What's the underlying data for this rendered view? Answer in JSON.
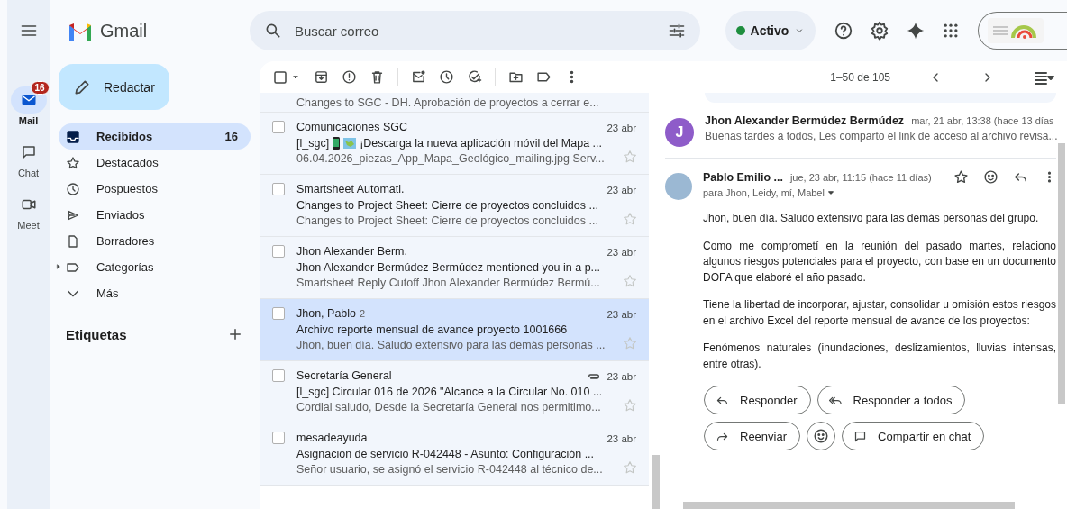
{
  "rail": {
    "items": [
      {
        "label": "Mail",
        "badge": "16",
        "selected": true
      },
      {
        "label": "Chat",
        "selected": false
      },
      {
        "label": "Meet",
        "selected": false
      }
    ]
  },
  "header": {
    "app_name": "Gmail",
    "search": {
      "placeholder": "Buscar correo"
    },
    "status": {
      "label": "Activo",
      "online": true
    }
  },
  "compose": "Redactar",
  "nav": {
    "items": [
      {
        "label": "Recibidos",
        "count": "16",
        "selected": true
      },
      {
        "label": "Destacados",
        "selected": false
      },
      {
        "label": "Pospuestos",
        "selected": false
      },
      {
        "label": "Enviados",
        "selected": false
      },
      {
        "label": "Borradores",
        "selected": false
      },
      {
        "label": "Categorías",
        "selected": false,
        "expanded": false
      },
      {
        "label": "Más",
        "selected": false
      }
    ],
    "labels_heading": "Etiquetas"
  },
  "toolbar": {
    "select_all": false,
    "range": "1–50 de 105"
  },
  "list": {
    "cut_snippet": "Changes to SGC - DH. Aprobación de proyectos a cerrar e...",
    "rows": [
      {
        "sender": "Comunicaciones SGC",
        "subject_prefix": "[l_sgc]",
        "inline_icons": true,
        "subject": "¡Descarga la nueva aplicación móvil del Mapa ...",
        "snippet": "06.04.2026_piezas_App_Mapa_Geológico_mailing.jpg Serv...",
        "date": "23 abr",
        "attachment": false,
        "selected": false,
        "checked": false,
        "starred": false
      },
      {
        "sender": "Smartsheet Automati.",
        "subject": "Changes to Project Sheet: Cierre de proyectos concluidos ...",
        "snippet": "Changes to Project Sheet: Cierre de proyectos concluidos ...",
        "date": "23 abr",
        "attachment": false,
        "selected": false,
        "checked": false,
        "starred": false
      },
      {
        "sender": "Jhon Alexander Berm.",
        "subject": "Jhon Alexander Bermúdez Bermúdez mentioned you in a p...",
        "snippet": "Smartsheet Reply Cutoff Jhon Alexander Bermúdez Bermú...",
        "date": "23 abr",
        "attachment": false,
        "selected": false,
        "checked": false,
        "starred": false
      },
      {
        "sender": "Jhon, Pablo",
        "thread_count": "2",
        "subject": "Archivo reporte mensual de avance proyecto 1001666",
        "snippet": "Jhon, buen día. Saludo extensivo para las demás personas ...",
        "date": "23 abr",
        "attachment": false,
        "selected": true,
        "checked": false,
        "starred": false
      },
      {
        "sender": "Secretaría General",
        "subject": "[l_sgc] Circular 016 de 2026 \"Alcance a la Circular No. 010 ...",
        "snippet": "Cordial saludo, Desde la Secretaría General nos permitimo...",
        "date": "23 abr",
        "attachment": true,
        "selected": false,
        "checked": false,
        "starred": false
      },
      {
        "sender": "mesadeayuda",
        "subject": "Asignación de servicio R-042448 - Asunto: Configuración ...",
        "snippet": "Señor usuario, se asignó el servicio R-042448 al técnico de...",
        "date": "23 abr",
        "attachment": false,
        "selected": false,
        "checked": false,
        "starred": false
      }
    ]
  },
  "thread": {
    "messages": [
      {
        "kind": "collapsed",
        "avatar_letter": "J",
        "sender": "Jhon Alexander Bermúdez Bermúdez",
        "date": "mar, 21 abr, 13:38 (hace 13 días",
        "snippet": "Buenas tardes a todos, Les comparto el link de acceso al archivo revisa..."
      },
      {
        "kind": "expanded",
        "sender": "Pablo Emilio ...",
        "date": "jue, 23 abr, 11:15 (hace 11 días)",
        "starred": false,
        "recipients": "para Jhon, Leidy, mí, Mabel",
        "body": [
          "Jhon, buen día. Saludo extensivo para las demás personas del grupo.",
          "Como me comprometí en la reunión del pasado martes, relaciono algunos riesgos potenciales para el proyecto, con base en un documento DOFA que elaboré el año pasado.",
          "Tiene la libertad de incorporar, ajustar, consolidar u omisión estos riesgos en el archivo Excel del reporte mensual de avance de los proyectos:",
          "Fenómenos naturales (inundaciones, deslizamientos, lluvias intensas, entre otras)."
        ]
      }
    ],
    "actions": [
      {
        "kind": "text",
        "label": "Responder"
      },
      {
        "kind": "text",
        "label": "Responder a todos"
      },
      {
        "kind": "text",
        "label": "Reenviar"
      },
      {
        "kind": "icon"
      },
      {
        "kind": "text",
        "label": "Compartir en chat"
      }
    ]
  }
}
